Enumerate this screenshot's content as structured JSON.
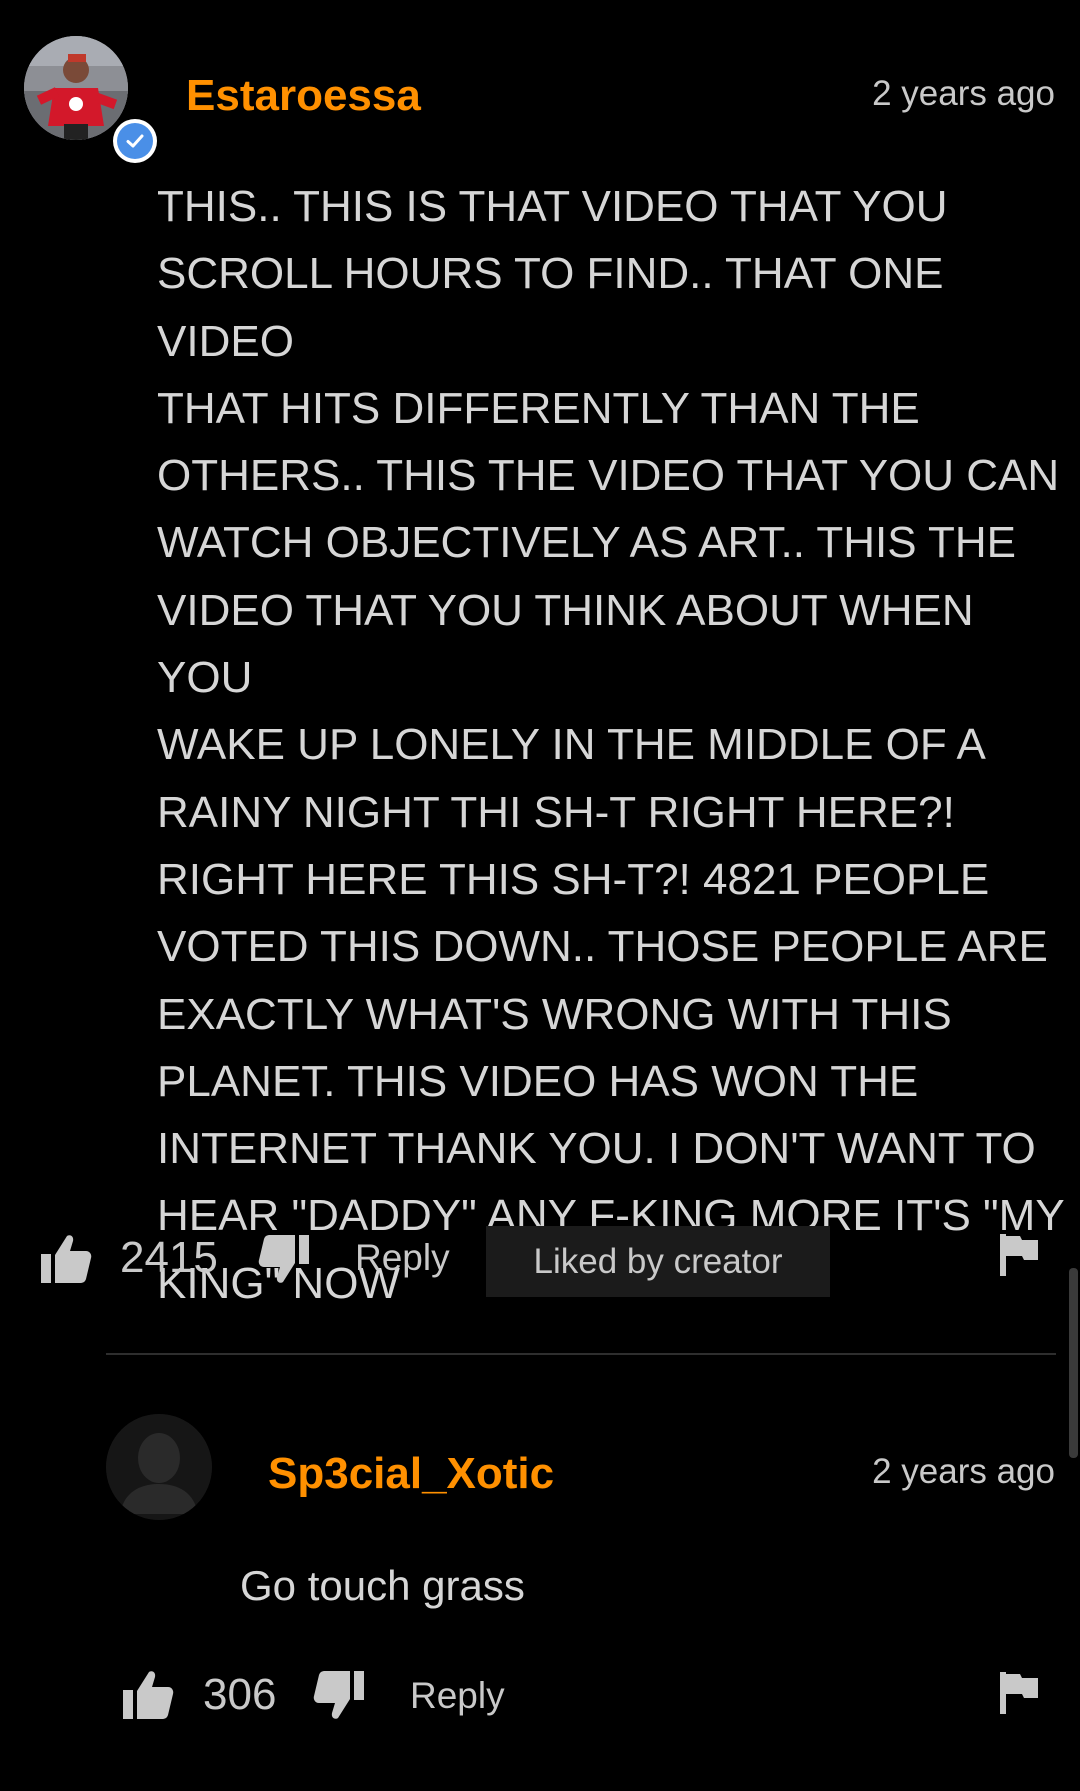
{
  "comments": [
    {
      "username": "Estaroessa",
      "verified": true,
      "timestamp": "2 years ago",
      "text": "THIS.. THIS IS THAT VIDEO THAT YOU\nSCROLL HOURS TO FIND.. THAT ONE VIDEO\nTHAT HITS DIFFERENTLY THAN THE\nOTHERS.. THIS THE VIDEO THAT YOU CAN\nWATCH OBJECTIVELY AS ART.. THIS THE\nVIDEO THAT YOU THINK ABOUT WHEN YOU\nWAKE UP LONELY IN THE MIDDLE OF A\nRAINY NIGHT THI SH-T RIGHT HERE?!\nRIGHT HERE THIS SH-T?! 4821 PEOPLE\nVOTED THIS DOWN.. THOSE PEOPLE ARE\nEXACTLY WHAT'S WRONG WITH THIS\nPLANET. THIS VIDEO HAS WON THE\nINTERNET THANK YOU. I DON'T WANT TO\nHEAR \"DADDY\" ANY F-KING MORE IT'S \"MY\nKING\" NOW",
      "likes": "2415",
      "reply_label": "Reply",
      "badge": "Liked by creator"
    },
    {
      "username": "Sp3cial_Xotic",
      "verified": false,
      "timestamp": "2 years ago",
      "text": "Go touch grass",
      "likes": "306",
      "reply_label": "Reply"
    }
  ],
  "colors": {
    "background": "#000000",
    "username": "#ff9000",
    "text": "#d6d6d6",
    "muted": "#c9c9c9",
    "verified": "#4a8fe7",
    "badge_bg": "#1b1b1b"
  },
  "icons": {
    "like": "thumbs-up-icon",
    "dislike": "thumbs-down-icon",
    "flag": "flag-icon",
    "verified": "verified-check-icon"
  }
}
